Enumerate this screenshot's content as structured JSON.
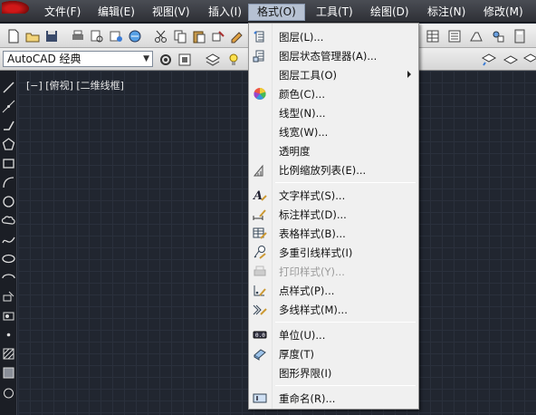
{
  "menubar": {
    "items": [
      {
        "label": "文件(F)"
      },
      {
        "label": "编辑(E)"
      },
      {
        "label": "视图(V)"
      },
      {
        "label": "插入(I)"
      },
      {
        "label": "格式(O)"
      },
      {
        "label": "工具(T)"
      },
      {
        "label": "绘图(D)"
      },
      {
        "label": "标注(N)"
      },
      {
        "label": "修改(M)"
      }
    ]
  },
  "workspace": {
    "selected": "AutoCAD 经典"
  },
  "viewport": {
    "label": "[−] [俯视] [二维线框]"
  },
  "format_menu": {
    "items": [
      {
        "label": "图层(L)...",
        "icon": "layers-icon"
      },
      {
        "label": "图层状态管理器(A)...",
        "icon": "layer-state-manager-icon"
      },
      {
        "label": "图层工具(O)",
        "icon": "",
        "submenu": true
      },
      {
        "label": "颜色(C)...",
        "icon": "color-wheel-icon"
      },
      {
        "label": "线型(N)...",
        "icon": ""
      },
      {
        "label": "线宽(W)...",
        "icon": ""
      },
      {
        "label": "透明度",
        "icon": ""
      },
      {
        "label": "比例缩放列表(E)...",
        "icon": "scale-list-icon"
      },
      {
        "label": "文字样式(S)...",
        "icon": "text-style-icon"
      },
      {
        "label": "标注样式(D)...",
        "icon": "dimension-style-icon"
      },
      {
        "label": "表格样式(B)...",
        "icon": "table-style-icon"
      },
      {
        "label": "多重引线样式(I)",
        "icon": "multileader-style-icon"
      },
      {
        "label": "打印样式(Y)...",
        "icon": "plot-style-icon",
        "disabled": true
      },
      {
        "label": "点样式(P)...",
        "icon": "point-style-icon"
      },
      {
        "label": "多线样式(M)...",
        "icon": "multiline-style-icon"
      },
      {
        "label": "单位(U)...",
        "icon": "units-icon"
      },
      {
        "label": "厚度(T)",
        "icon": "thickness-icon"
      },
      {
        "label": "图形界限(I)",
        "icon": ""
      },
      {
        "label": "重命名(R)...",
        "icon": "rename-icon"
      }
    ]
  }
}
